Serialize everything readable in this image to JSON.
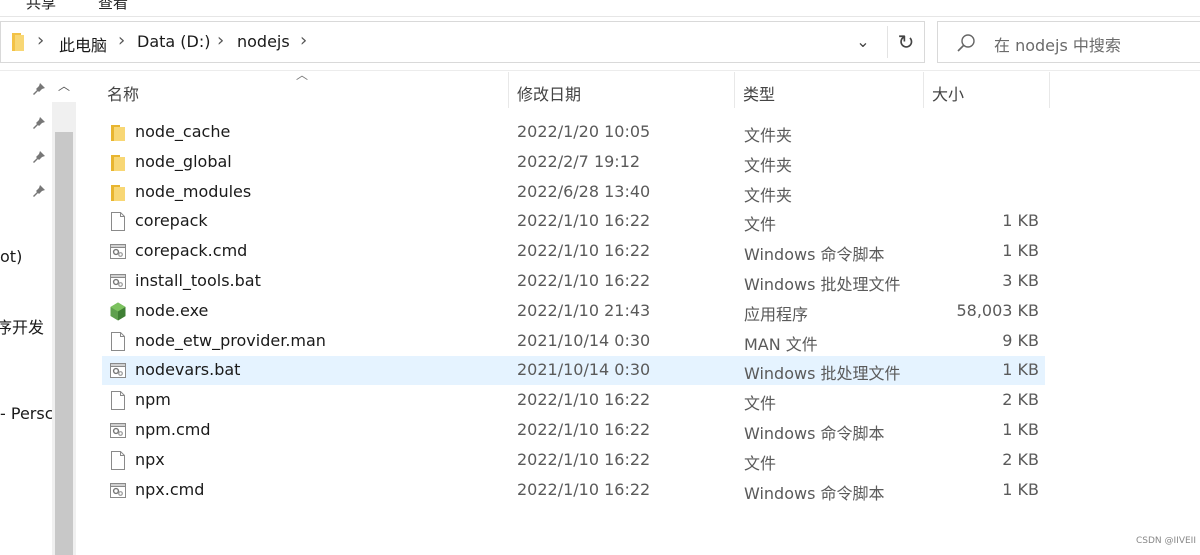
{
  "ribbon": {
    "tabs": [
      "共享",
      "查看"
    ]
  },
  "address": {
    "crumbs": [
      "此电脑",
      "Data (D:)",
      "nodejs"
    ]
  },
  "search": {
    "placeholder": "在 nodejs 中搜索"
  },
  "nav": {
    "fragments": [
      "ot)",
      "序开发",
      "- Persc"
    ]
  },
  "columns": {
    "name": "名称",
    "date": "修改日期",
    "type": "类型",
    "size": "大小"
  },
  "files": [
    {
      "name": "node_cache",
      "date": "2022/1/20 10:05",
      "type": "文件夹",
      "size": "",
      "icon": "folder-icon"
    },
    {
      "name": "node_global",
      "date": "2022/2/7 19:12",
      "type": "文件夹",
      "size": "",
      "icon": "folder-icon"
    },
    {
      "name": "node_modules",
      "date": "2022/6/28 13:40",
      "type": "文件夹",
      "size": "",
      "icon": "folder-icon"
    },
    {
      "name": "corepack",
      "date": "2022/1/10 16:22",
      "type": "文件",
      "size": "1 KB",
      "icon": "blank-file-icon"
    },
    {
      "name": "corepack.cmd",
      "date": "2022/1/10 16:22",
      "type": "Windows 命令脚本",
      "size": "1 KB",
      "icon": "script-file-icon"
    },
    {
      "name": "install_tools.bat",
      "date": "2022/1/10 16:22",
      "type": "Windows 批处理文件",
      "size": "3 KB",
      "icon": "script-file-icon"
    },
    {
      "name": "node.exe",
      "date": "2022/1/10 21:43",
      "type": "应用程序",
      "size": "58,003 KB",
      "icon": "nodejs-exe-icon"
    },
    {
      "name": "node_etw_provider.man",
      "date": "2021/10/14 0:30",
      "type": "MAN 文件",
      "size": "9 KB",
      "icon": "blank-file-icon"
    },
    {
      "name": "nodevars.bat",
      "date": "2021/10/14 0:30",
      "type": "Windows 批处理文件",
      "size": "1 KB",
      "icon": "script-file-icon",
      "selected": true
    },
    {
      "name": "npm",
      "date": "2022/1/10 16:22",
      "type": "文件",
      "size": "2 KB",
      "icon": "blank-file-icon"
    },
    {
      "name": "npm.cmd",
      "date": "2022/1/10 16:22",
      "type": "Windows 命令脚本",
      "size": "1 KB",
      "icon": "script-file-icon"
    },
    {
      "name": "npx",
      "date": "2022/1/10 16:22",
      "type": "文件",
      "size": "2 KB",
      "icon": "blank-file-icon"
    },
    {
      "name": "npx.cmd",
      "date": "2022/1/10 16:22",
      "type": "Windows 命令脚本",
      "size": "1 KB",
      "icon": "script-file-icon"
    }
  ],
  "watermark": "CSDN @IIVEII"
}
